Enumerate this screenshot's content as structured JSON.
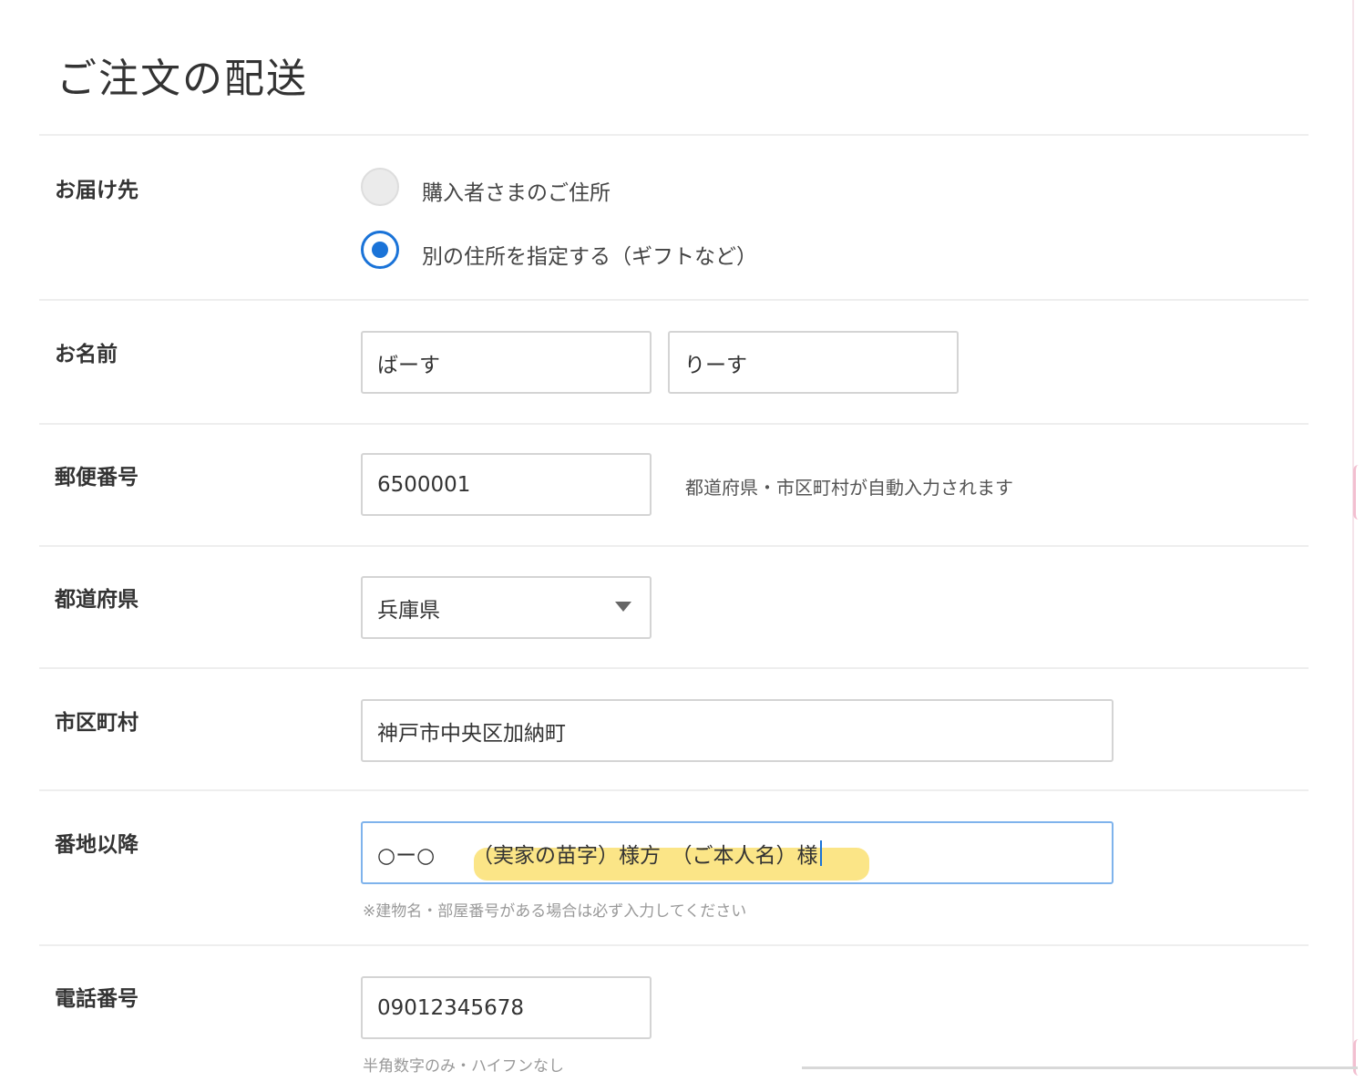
{
  "page": {
    "title": "ご注文の配送"
  },
  "delivery": {
    "label": "お届け先",
    "options": [
      {
        "label": "購入者さまのご住所",
        "selected": false
      },
      {
        "label": "別の住所を指定する（ギフトなど）",
        "selected": true
      }
    ]
  },
  "name": {
    "label": "お名前",
    "last_name": "ばーす",
    "first_name": "りーす"
  },
  "postal": {
    "label": "郵便番号",
    "value": "6500001",
    "helper": "都道府県・市区町村が自動入力されます"
  },
  "prefecture": {
    "label": "都道府県",
    "value": "兵庫県"
  },
  "city": {
    "label": "市区町村",
    "value": "神戸市中央区加納町"
  },
  "street": {
    "label": "番地以降",
    "number_part": "○ー○",
    "value": "（実家の苗字）様方　（ご本人名）様",
    "helper": "※建物名・部屋番号がある場合は必ず入力してください",
    "highlight_color": "#fbe27a"
  },
  "phone": {
    "label": "電話番号",
    "value": "09012345678",
    "helper": "半角数字のみ・ハイフンなし"
  },
  "colors": {
    "accent": "#1a73d8",
    "focus_border": "#7fb3ec"
  }
}
